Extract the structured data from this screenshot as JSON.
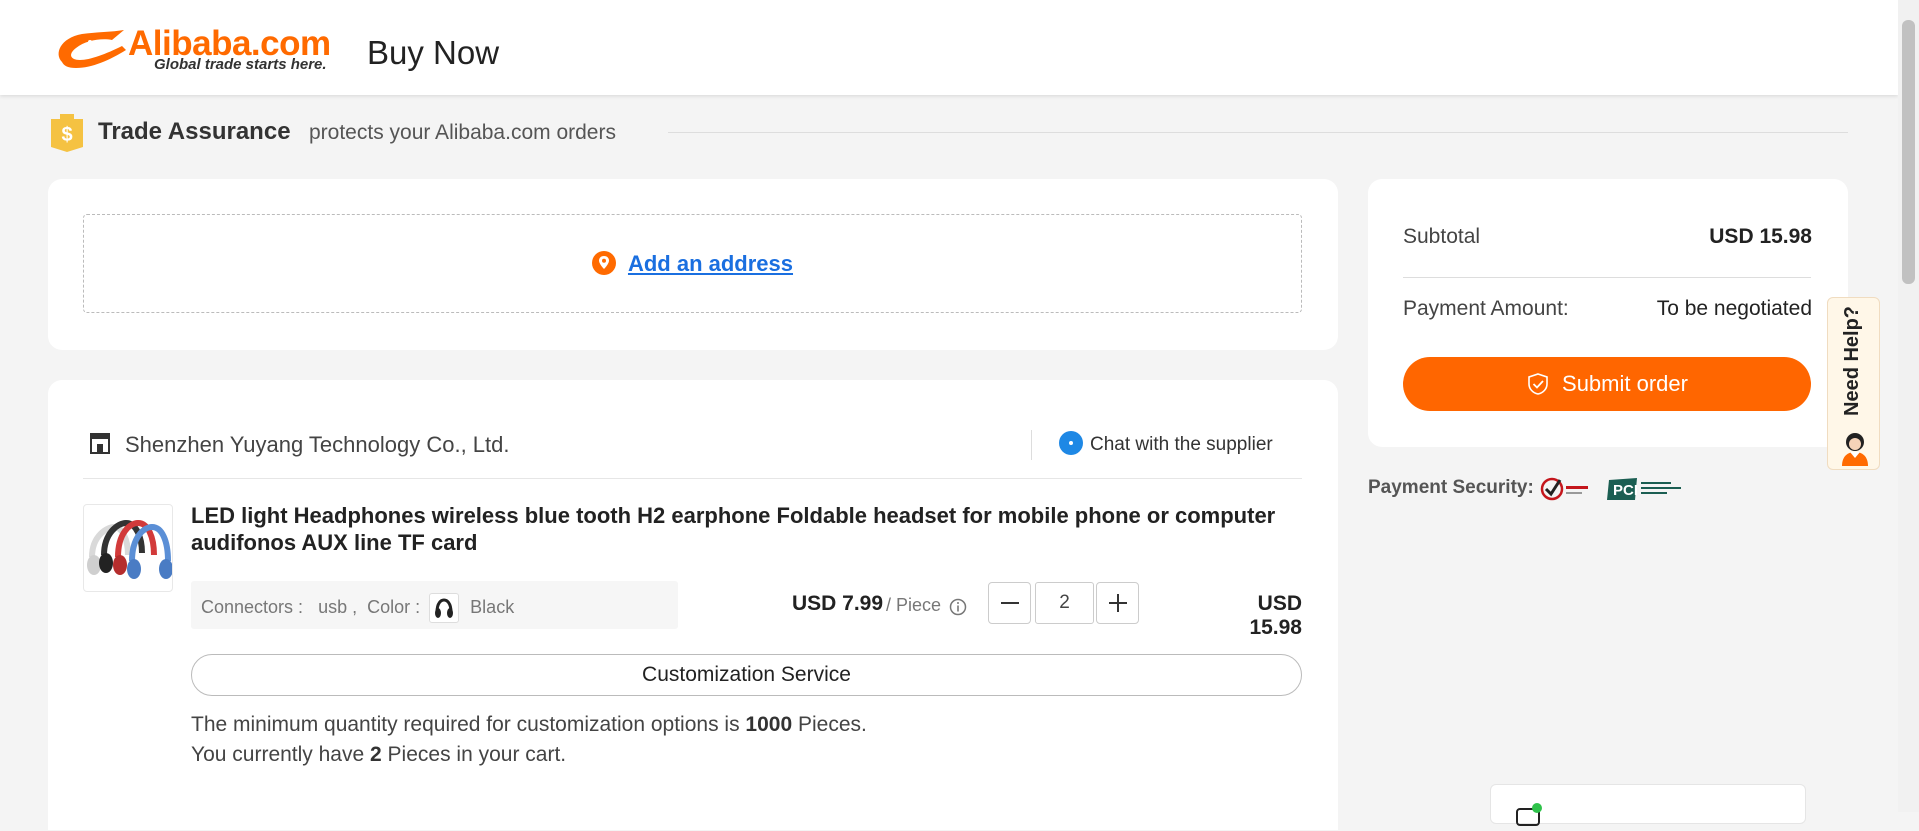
{
  "header": {
    "logo_word": "Alibaba.com",
    "logo_tagline": "Global trade starts here.",
    "page_title": "Buy Now"
  },
  "trade_assurance": {
    "title": "Trade Assurance",
    "description": "protects your Alibaba.com orders"
  },
  "address": {
    "link_label": "Add an address"
  },
  "order": {
    "supplier_name": "Shenzhen Yuyang Technology Co., Ltd.",
    "chat_label": "Chat with the supplier",
    "product_title": "LED light Headphones wireless blue tooth H2 earphone Foldable headset for mobile phone or computer audifonos AUX line TF card",
    "options": {
      "connectors_label": "Connectors :",
      "connectors_value": "usb ,",
      "color_label": "Color :",
      "color_value": "Black"
    },
    "unit_price": "USD 7.99",
    "unit_label": "/ Piece",
    "quantity": "2",
    "line_total": "USD 15.98",
    "customization_label": "Customization Service",
    "min_note": {
      "line1_prefix": "The minimum quantity required for customization options is",
      "line1_qty": "1000",
      "line1_suffix": "Pieces.",
      "line2_prefix": "You currently have",
      "line2_qty": "2",
      "line2_suffix": "Pieces in your cart."
    }
  },
  "summary": {
    "subtotal_label": "Subtotal",
    "subtotal_value": "USD 15.98",
    "payment_label": "Payment Amount:",
    "payment_value": "To be negotiated",
    "submit_label": "Submit order"
  },
  "payment_security": {
    "label": "Payment Security:"
  },
  "help": {
    "label": "Need Help?"
  },
  "colors": {
    "brand_orange": "#ff6600",
    "link_blue": "#1a6fe0",
    "background": "#f4f4f4"
  }
}
